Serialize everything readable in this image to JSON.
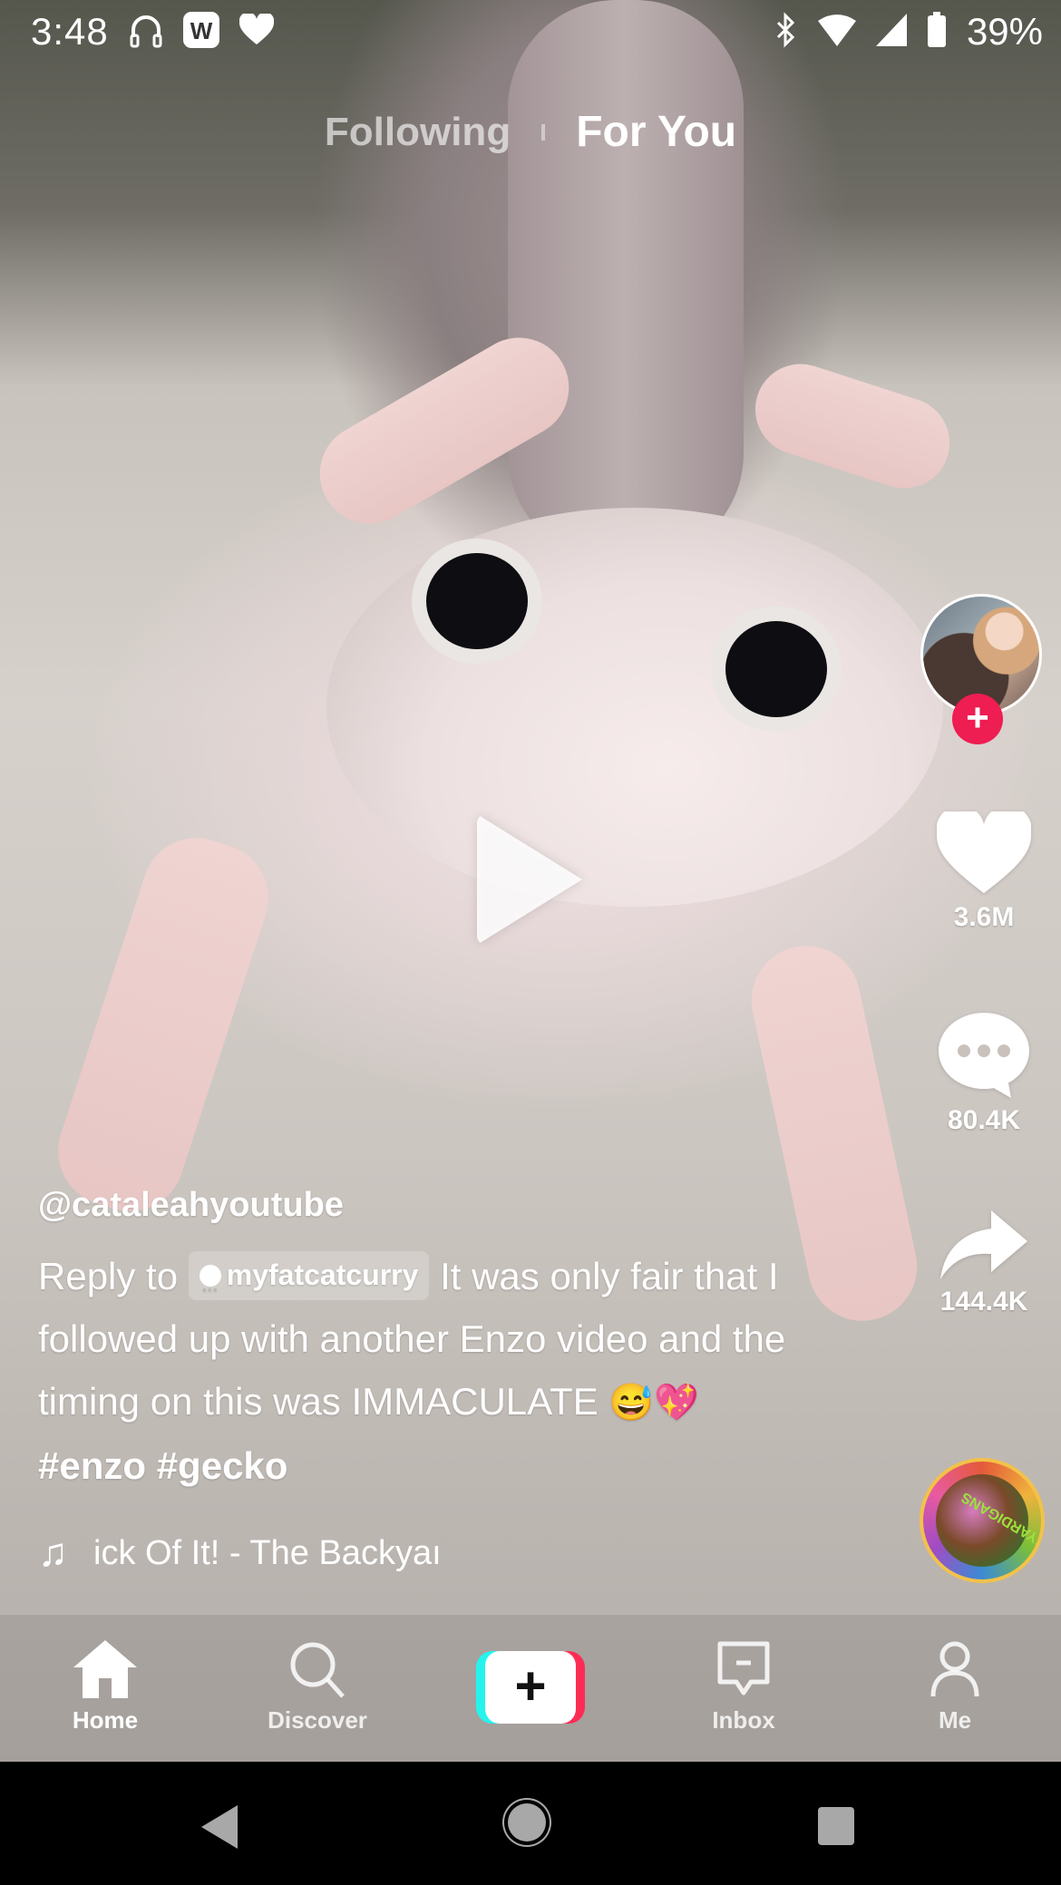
{
  "status_bar": {
    "time": "3:48",
    "left_icons": [
      "headphones-icon",
      "w-app-icon",
      "heart-icon"
    ],
    "right_icons": [
      "bluetooth-icon",
      "wifi-icon",
      "signal-icon",
      "battery-icon"
    ],
    "battery_percent": "39%"
  },
  "top_tabs": {
    "following": "Following",
    "for_you": "For You",
    "active": "For You"
  },
  "player": {
    "state": "paused",
    "play_icon": "play-icon"
  },
  "actions": {
    "follow_symbol": "+",
    "likes": "3.6M",
    "comments": "80.4K",
    "shares": "144.4K"
  },
  "post": {
    "username": "@cataleahyoutube",
    "reply_prefix": "Reply to",
    "reply_user": "myfatcatcurry",
    "description_line1": "It was only",
    "description_rest": "fair that I followed up with another Enzo video and the timing on this was IMMACULATE",
    "emojis": "😅💖",
    "hashtags": [
      "#enzo",
      "#gecko"
    ],
    "music": "ick Of It! - The Backyaı",
    "music_disc_label": "The BACKYARDIGANS"
  },
  "bottom_nav": {
    "items": [
      {
        "label": "Home",
        "icon": "home-icon",
        "active": true
      },
      {
        "label": "Discover",
        "icon": "search-icon",
        "active": false
      },
      {
        "label": "+",
        "icon": "create-icon",
        "active": false
      },
      {
        "label": "Inbox",
        "icon": "inbox-icon",
        "active": false
      },
      {
        "label": "Me",
        "icon": "profile-icon",
        "active": false
      }
    ]
  },
  "colors": {
    "accent_red": "#fe2c55",
    "accent_cyan": "#25f4ee",
    "follow_red": "#ee1d52"
  }
}
